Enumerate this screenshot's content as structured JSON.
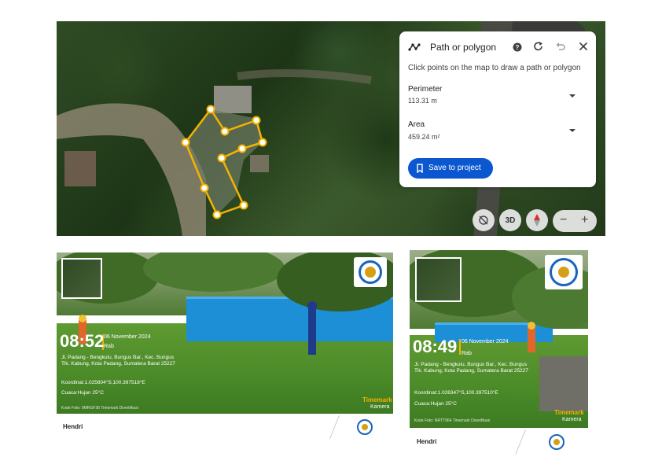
{
  "panel": {
    "title": "Path or polygon",
    "hint": "Click points on the map to draw a path or polygon",
    "perimeter_label": "Perimeter",
    "perimeter_value": "113.31 m",
    "area_label": "Area",
    "area_value": "459.24 m²",
    "save_label": "Save to project",
    "icons": [
      "path-polygon-icon",
      "help-icon",
      "redo-icon",
      "undo-icon",
      "close-icon"
    ]
  },
  "map_controls": {
    "three_d_label": "3D",
    "zoom_out": "−",
    "zoom_in": "+",
    "icons": [
      "rotate-lock-icon",
      "compass-icon"
    ]
  },
  "photos": [
    {
      "time": "08:52",
      "date": "06 November 2024",
      "day": "Rab",
      "address": "Jl. Padang - Bengkulu, Bungus Bar., Kec. Bungus Tlk. Kabung, Kota Padang, Sumatera Barat 25227",
      "coords": "Koordinat:1.025804°S,100.397518°E",
      "weather": "Cuaca:Hujan 25°C",
      "code": "Kode Foto: 9MRGF36 Timemark Diverifikasi",
      "brand_top": "Timemark",
      "brand_bottom": "Kamera",
      "caption": "Hendri"
    },
    {
      "time": "08:49",
      "date": "06 November 2024",
      "day": "Rab",
      "address": "Jl. Padang - Bengkulu, Bungus Bar., Kec. Bungus Tlk. Kabung, Kota Padang, Sumatera Barat 25227",
      "coords": "Koordinat:1.026347°S,100.397510°E",
      "weather": "Cuaca:Hujan 25°C",
      "code": "Kode Foto: NRTT964 Timemark Diverifikasi",
      "brand_top": "Timemark",
      "brand_bottom": "Kamera",
      "caption": "Hendri"
    }
  ],
  "colors": {
    "accent": "#0b57d0",
    "polygon": "#f5b301",
    "brand": "#f5b301"
  }
}
